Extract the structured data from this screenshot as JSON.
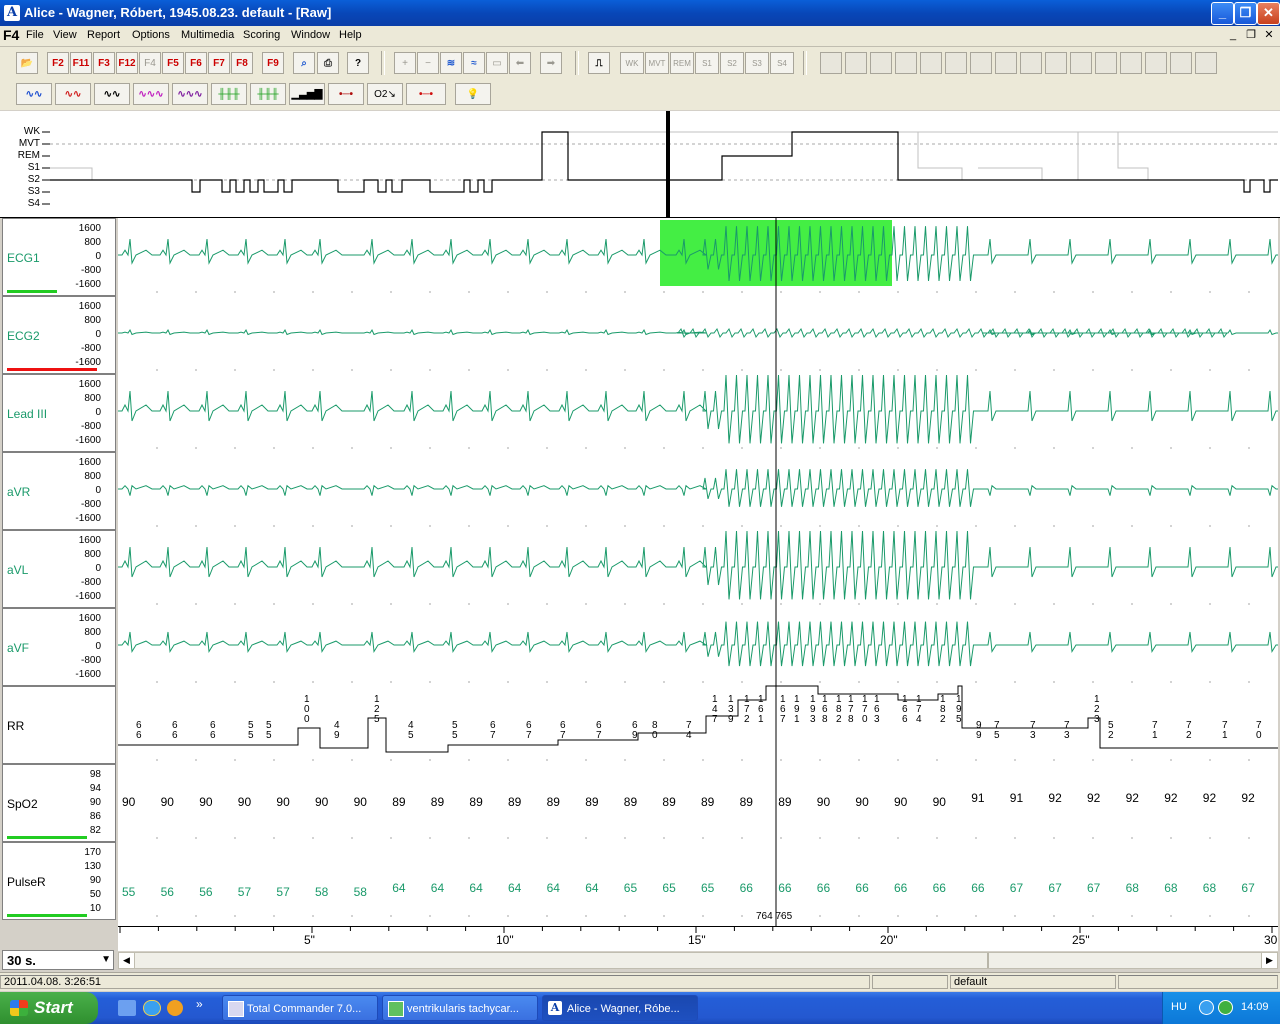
{
  "window": {
    "title": "Alice - Wagner, Róbert, 1945.08.23. default - [Raw]",
    "icon": "A",
    "minimize": "_",
    "maximize": "❐",
    "close": "✕"
  },
  "menu": {
    "logo": "F4",
    "items": [
      "File",
      "View",
      "Report",
      "Options",
      "Multimedia",
      "Scoring",
      "Window",
      "Help"
    ],
    "mdi": [
      "_",
      "❐",
      "✕"
    ]
  },
  "toolbar1": {
    "fkeys": [
      "F2",
      "F11",
      "F3",
      "F12",
      "F4",
      "F5",
      "F6",
      "F7",
      "F8",
      "F9"
    ],
    "score_buttons": [
      "WK",
      "MVT",
      "REM",
      "S1",
      "S2",
      "S3",
      "S4"
    ]
  },
  "toolbar2": {
    "o2_label": "O2↘"
  },
  "hypnogram": {
    "stages": [
      "WK",
      "MVT",
      "REM",
      "S1",
      "S2",
      "S3",
      "S4"
    ]
  },
  "channels": [
    {
      "name": "ECG1",
      "ticks": [
        "1600",
        "800",
        "0",
        "-800",
        "-1600"
      ],
      "bar_color": "#22cc22",
      "bar_level": 0.5
    },
    {
      "name": "ECG2",
      "ticks": [
        "1600",
        "800",
        "0",
        "-800",
        "-1600"
      ],
      "bar_color": "#ee1111",
      "bar_level": 0.9
    },
    {
      "name": "Lead III",
      "ticks": [
        "1600",
        "800",
        "0",
        "-800",
        "-1600"
      ]
    },
    {
      "name": "aVR",
      "ticks": [
        "1600",
        "800",
        "0",
        "-800",
        "-1600"
      ]
    },
    {
      "name": "aVL",
      "ticks": [
        "1600",
        "800",
        "0",
        "-800",
        "-1600"
      ]
    },
    {
      "name": "aVF",
      "ticks": [
        "1600",
        "800",
        "0",
        "-800",
        "-1600"
      ]
    },
    {
      "name": "RR",
      "ticks": []
    },
    {
      "name": "SpO2",
      "ticks": [
        "98",
        "94",
        "90",
        "86",
        "82"
      ],
      "bar_color": "#22cc22",
      "bar_level": 0.8
    },
    {
      "name": "PulseR",
      "ticks": [
        "170",
        "130",
        "90",
        "50",
        "10"
      ],
      "bar_color": "#22cc22",
      "bar_level": 0.8
    }
  ],
  "rr_values": [
    "66",
    "66",
    "66",
    "55",
    "55",
    "100",
    "49",
    "125",
    "45",
    "55",
    "67",
    "67",
    "67",
    "67",
    "69",
    "80",
    "74",
    "147",
    "139",
    "172",
    "161",
    "167",
    "191",
    "193",
    "168",
    "182",
    "178",
    "170",
    "163",
    "166",
    "174",
    "182",
    "195",
    "99",
    "75",
    "73",
    "73",
    "123",
    "52",
    "71",
    "72",
    "71",
    "70"
  ],
  "spo2_values": [
    "90",
    "90",
    "90",
    "90",
    "90",
    "90",
    "90",
    "89",
    "89",
    "89",
    "89",
    "89",
    "89",
    "89",
    "89",
    "89",
    "89",
    "89",
    "90",
    "90",
    "90",
    "90",
    "91",
    "91",
    "92",
    "92",
    "92",
    "92",
    "92",
    "92"
  ],
  "pulse_values": [
    "55",
    "56",
    "56",
    "57",
    "57",
    "58",
    "58",
    "64",
    "64",
    "64",
    "64",
    "64",
    "64",
    "65",
    "65",
    "65",
    "66",
    "66",
    "66",
    "66",
    "66",
    "66",
    "66",
    "67",
    "67",
    "67",
    "68",
    "68",
    "68",
    "67"
  ],
  "cursor_label": "764 765",
  "time_axis": {
    "labels": [
      "5\"",
      "10\"",
      "15\"",
      "20\"",
      "25\"",
      "30"
    ],
    "seconds": [
      5,
      10,
      15,
      20,
      25,
      30
    ],
    "span": 30
  },
  "zoom": {
    "value": "30 s.",
    "arrow": "▼"
  },
  "status": {
    "datetime": "2011.04.08. 3:26:51",
    "profile": "default"
  },
  "taskbar": {
    "start": "Start",
    "tasks": [
      "Total Commander 7.0...",
      "ventrikularis tachycar...",
      "Alice - Wagner, Róbe..."
    ],
    "lang": "HU",
    "time": "14:09",
    "chevron": "»"
  },
  "colors": {
    "trace": "#1a9a6a",
    "highlight": "#44ee44",
    "title_bar": "#0a4fc8",
    "taskbar": "#245ed8"
  }
}
